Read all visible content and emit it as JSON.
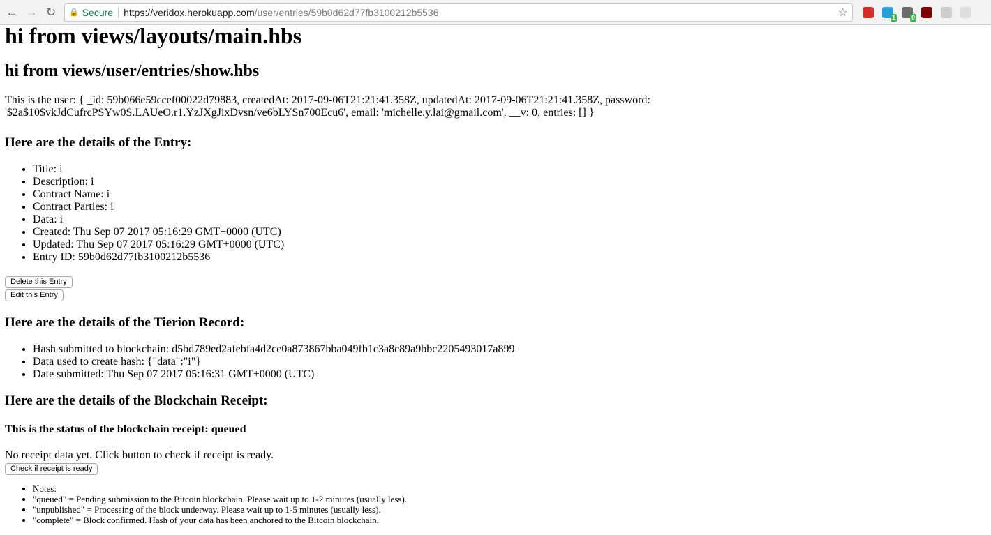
{
  "browser": {
    "secure_label": "Secure",
    "url_host": "https://veridox.herokuapp.com",
    "url_path": "/user/entries/59b0d62d77fb3100212b5536",
    "extensions": [
      {
        "name": "lastpass-icon",
        "color": "#d32d27",
        "badge": ""
      },
      {
        "name": "skype-icon",
        "color": "#2a9fd6",
        "badge": "1"
      },
      {
        "name": "extension-icon",
        "color": "#6b6b6b",
        "badge": "0"
      },
      {
        "name": "ublock-icon",
        "color": "#800000",
        "badge": ""
      },
      {
        "name": "extension-icon-gray",
        "color": "#cccccc",
        "badge": ""
      },
      {
        "name": "extension-icon-circle",
        "color": "#dddddd",
        "badge": ""
      }
    ]
  },
  "page": {
    "h1": "hi from views/layouts/main.hbs",
    "h2": "hi from views/user/entries/show.hbs",
    "user_line": "This is the user: { _id: 59b066e59ccef00022d79883, createdAt: 2017-09-06T21:21:41.358Z, updatedAt: 2017-09-06T21:21:41.358Z, password: '$2a$10$vkJdCufrcPSYw0S.LAUeO.r1.YzJXgJixDvsn/ve6bLYSn700Ecu6', email: 'michelle.y.lai@gmail.com', __v: 0, entries: [] }",
    "entry_heading": "Here are the details of the Entry:",
    "entry_items": [
      "Title: i",
      "Description: i",
      "Contract Name: i",
      "Contract Parties: i",
      "Data: i",
      "Created: Thu Sep 07 2017 05:16:29 GMT+0000 (UTC)",
      "Updated: Thu Sep 07 2017 05:16:29 GMT+0000 (UTC)",
      "Entry ID: 59b0d62d77fb3100212b5536"
    ],
    "delete_button": "Delete this Entry",
    "edit_button": "Edit this Entry",
    "tierion_heading": "Here are the details of the Tierion Record:",
    "tierion_items": [
      "Hash submitted to blockchain: d5bd789ed2afebfa4d2ce0a873867bba049fb1c3a8c89a9bbc2205493017a899",
      "Data used to create hash: {\"data\":\"i\"}",
      "Date submitted: Thu Sep 07 2017 05:16:31 GMT+0000 (UTC)"
    ],
    "blockchain_heading": "Here are the details of the Blockchain Receipt:",
    "status_heading": "This is the status of the blockchain receipt: queued",
    "no_receipt_text": "No receipt data yet. Click button to check if receipt is ready.",
    "check_button": "Check if receipt is ready",
    "notes": [
      "Notes:",
      "\"queued\" = Pending submission to the Bitcoin blockchain. Please wait up to 1-2 minutes (usually less).",
      "\"unpublished\" = Processing of the block underway. Please wait up to 1-5 minutes (usually less).",
      "\"complete\" = Block confirmed. Hash of your data has been anchored to the Bitcoin blockchain."
    ]
  }
}
